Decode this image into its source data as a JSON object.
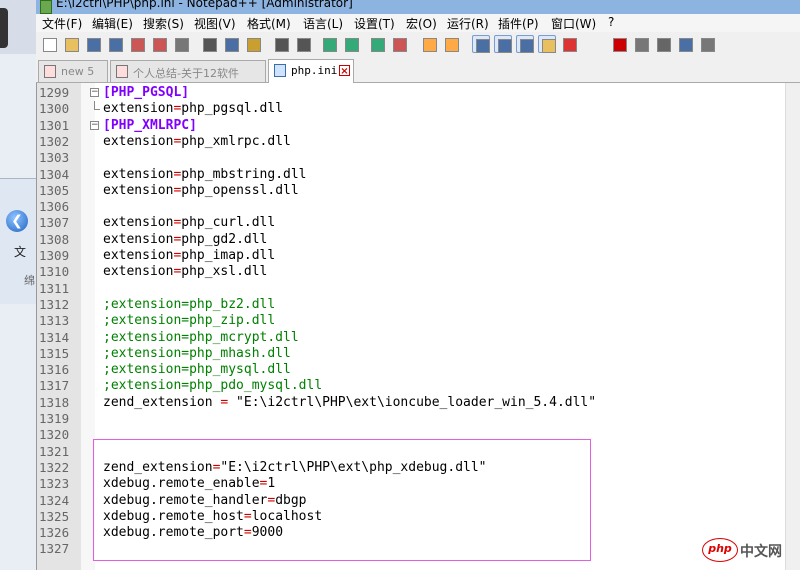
{
  "window": {
    "title": "E:\\i2ctrl\\PHP\\php.ini - Notepad++ [Administrator]"
  },
  "background_window": {
    "text": "文",
    "sub": "绵"
  },
  "menu": [
    "文件(F)",
    "编辑(E)",
    "搜索(S)",
    "视图(V)",
    "格式(M)",
    "语言(L)",
    "设置(T)",
    "宏(O)",
    "运行(R)",
    "插件(P)",
    "窗口(W)",
    "?"
  ],
  "tabs": [
    {
      "label": "new 5",
      "active": false
    },
    {
      "label": "个人总结-关于12软件",
      "active": false
    },
    {
      "label": "php.ini",
      "active": true
    }
  ],
  "toolbar_icons": [
    "new-file-icon",
    "open-file-icon",
    "save-icon",
    "save-all-icon",
    "close-icon",
    "close-all-icon",
    "print-icon",
    "cut-icon",
    "copy-icon",
    "paste-icon",
    "undo-icon",
    "redo-icon",
    "find-icon",
    "replace-icon",
    "zoom-in-icon",
    "zoom-out-icon",
    "sync-v-icon",
    "sync-h-icon",
    "wrap-icon",
    "all-chars-icon",
    "indent-guide-icon",
    "doc-map-icon",
    "function-list-icon",
    "record-macro-icon",
    "stop-macro-icon",
    "play-macro-icon",
    "run-macro-multiple-icon",
    "save-macro-icon"
  ],
  "lines": [
    {
      "n": "1299",
      "fold": "open",
      "parts": [
        {
          "t": "[PHP_PGSQL]",
          "c": "sec"
        }
      ]
    },
    {
      "n": "1300",
      "fold": "end",
      "parts": [
        {
          "t": "extension",
          "c": ""
        },
        {
          "t": "=",
          "c": "op"
        },
        {
          "t": "php_pgsql.dll",
          "c": ""
        }
      ]
    },
    {
      "n": "1301",
      "fold": "open",
      "parts": [
        {
          "t": "[PHP_XMLRPC]",
          "c": "sec"
        }
      ]
    },
    {
      "n": "1302",
      "fold": "line",
      "parts": [
        {
          "t": "extension",
          "c": ""
        },
        {
          "t": "=",
          "c": "op"
        },
        {
          "t": "php_xmlrpc.dll",
          "c": ""
        }
      ]
    },
    {
      "n": "1303",
      "fold": "line",
      "parts": []
    },
    {
      "n": "1304",
      "fold": "line",
      "parts": [
        {
          "t": "extension",
          "c": ""
        },
        {
          "t": "=",
          "c": "op"
        },
        {
          "t": "php_mbstring.dll",
          "c": ""
        }
      ]
    },
    {
      "n": "1305",
      "fold": "line",
      "parts": [
        {
          "t": "extension",
          "c": ""
        },
        {
          "t": "=",
          "c": "op"
        },
        {
          "t": "php_openssl.dll",
          "c": ""
        }
      ]
    },
    {
      "n": "1306",
      "fold": "line",
      "parts": []
    },
    {
      "n": "1307",
      "fold": "line",
      "parts": [
        {
          "t": "extension",
          "c": ""
        },
        {
          "t": "=",
          "c": "op"
        },
        {
          "t": "php_curl.dll",
          "c": ""
        }
      ]
    },
    {
      "n": "1308",
      "fold": "line",
      "parts": [
        {
          "t": "extension",
          "c": ""
        },
        {
          "t": "=",
          "c": "op"
        },
        {
          "t": "php_gd2.dll",
          "c": ""
        }
      ]
    },
    {
      "n": "1309",
      "fold": "line",
      "parts": [
        {
          "t": "extension",
          "c": ""
        },
        {
          "t": "=",
          "c": "op"
        },
        {
          "t": "php_imap.dll",
          "c": ""
        }
      ]
    },
    {
      "n": "1310",
      "fold": "line",
      "parts": [
        {
          "t": "extension",
          "c": ""
        },
        {
          "t": "=",
          "c": "op"
        },
        {
          "t": "php_xsl.dll",
          "c": ""
        }
      ]
    },
    {
      "n": "1311",
      "fold": "line",
      "parts": []
    },
    {
      "n": "1312",
      "fold": "line",
      "parts": [
        {
          "t": ";extension=php_bz2.dll",
          "c": "cm"
        }
      ]
    },
    {
      "n": "1313",
      "fold": "line",
      "parts": [
        {
          "t": ";extension=php_zip.dll",
          "c": "cm"
        }
      ]
    },
    {
      "n": "1314",
      "fold": "line",
      "parts": [
        {
          "t": ";extension=php_mcrypt.dll",
          "c": "cm"
        }
      ]
    },
    {
      "n": "1315",
      "fold": "line",
      "parts": [
        {
          "t": ";extension=php_mhash.dll",
          "c": "cm"
        }
      ]
    },
    {
      "n": "1316",
      "fold": "line",
      "parts": [
        {
          "t": ";extension=php_mysql.dll",
          "c": "cm"
        }
      ]
    },
    {
      "n": "1317",
      "fold": "line",
      "parts": [
        {
          "t": ";extension=php_pdo_mysql.dll",
          "c": "cm"
        }
      ]
    },
    {
      "n": "1318",
      "fold": "line",
      "parts": [
        {
          "t": "zend_extension ",
          "c": ""
        },
        {
          "t": "=",
          "c": "op"
        },
        {
          "t": " \"E:\\i2ctrl\\PHP\\ext\\ioncube_loader_win_5.4.dll\"",
          "c": ""
        }
      ]
    },
    {
      "n": "1319",
      "fold": "line",
      "parts": []
    },
    {
      "n": "1320",
      "fold": "line",
      "parts": []
    },
    {
      "n": "1321",
      "fold": "line",
      "parts": []
    },
    {
      "n": "1322",
      "fold": "line",
      "parts": [
        {
          "t": "zend_extension",
          "c": ""
        },
        {
          "t": "=",
          "c": "op"
        },
        {
          "t": "\"E:\\i2ctrl\\PHP\\ext\\php_xdebug.dll\"",
          "c": ""
        }
      ]
    },
    {
      "n": "1323",
      "fold": "line",
      "parts": [
        {
          "t": "xdebug.remote_enable",
          "c": ""
        },
        {
          "t": "=",
          "c": "op"
        },
        {
          "t": "1",
          "c": ""
        }
      ]
    },
    {
      "n": "1324",
      "fold": "line",
      "parts": [
        {
          "t": "xdebug.remote_handler",
          "c": ""
        },
        {
          "t": "=",
          "c": "op"
        },
        {
          "t": "dbgp",
          "c": ""
        }
      ]
    },
    {
      "n": "1325",
      "fold": "line",
      "parts": [
        {
          "t": "xdebug.remote_host",
          "c": ""
        },
        {
          "t": "=",
          "c": "op"
        },
        {
          "t": "localhost",
          "c": ""
        }
      ]
    },
    {
      "n": "1326",
      "fold": "line",
      "parts": [
        {
          "t": "xdebug.remote_port",
          "c": ""
        },
        {
          "t": "=",
          "c": "op"
        },
        {
          "t": "9000",
          "c": ""
        }
      ]
    },
    {
      "n": "1327",
      "fold": "line",
      "parts": []
    }
  ],
  "watermark": {
    "logo": "php",
    "text": "中文网"
  },
  "colors": {
    "operator": "#d00000",
    "section": "#8000ff",
    "comment": "#008000",
    "highlight_box": "#e060e0"
  }
}
